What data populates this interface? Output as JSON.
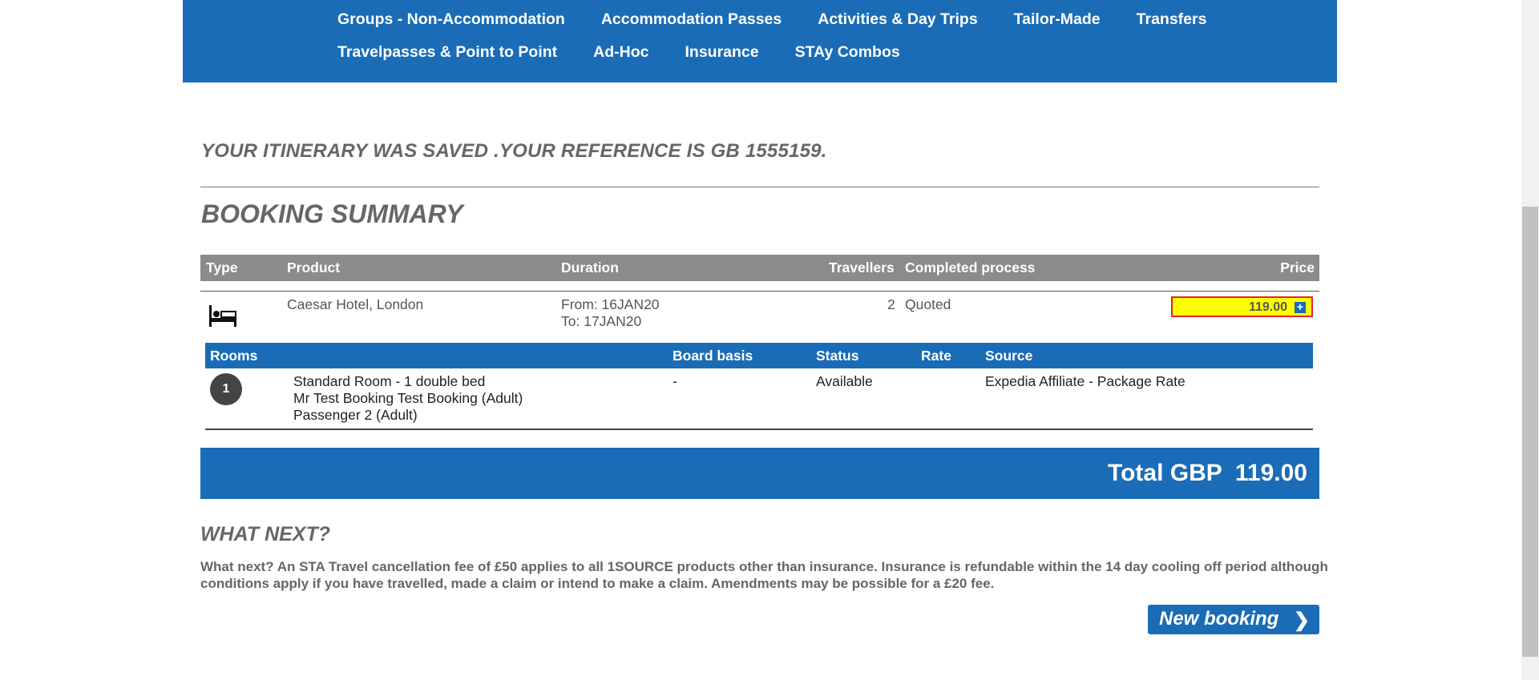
{
  "nav": {
    "row1": [
      "Groups - Non-Accommodation",
      "Accommodation Passes",
      "Activities & Day Trips",
      "Tailor-Made",
      "Transfers"
    ],
    "row2": [
      "Travelpasses & Point to Point",
      "Ad-Hoc",
      "Insurance",
      "STAy Combos"
    ]
  },
  "saved_message": "YOUR ITINERARY WAS SAVED .YOUR REFERENCE IS GB 1555159.",
  "summary_title": "BOOKING SUMMARY",
  "table": {
    "headers": {
      "type": "Type",
      "product": "Product",
      "duration": "Duration",
      "travellers": "Travellers",
      "completed": "Completed process",
      "price": "Price"
    },
    "row": {
      "icon": "bed-icon",
      "product": "Caesar Hotel, London",
      "from": "From: 16JAN20",
      "to": "To: 17JAN20",
      "travellers": "2",
      "status": "Quoted",
      "price": "119.00"
    }
  },
  "rooms": {
    "headers": {
      "rooms": "Rooms",
      "board": "Board basis",
      "status": "Status",
      "rate": "Rate",
      "source": "Source"
    },
    "row": {
      "number": "1",
      "room": "Standard Room - 1 double bed",
      "pax1": "Mr Test Booking Test Booking (Adult)",
      "pax2": "Passenger 2 (Adult)",
      "board": "-",
      "status": "Available",
      "rate": "",
      "source": "Expedia Affiliate - Package Rate"
    }
  },
  "total": "Total GBP  119.00",
  "what_next_title": "WHAT NEXT?",
  "what_next_text": "What next? An STA Travel cancellation fee of £50 applies to all 1SOURCE products other than insurance. Insurance is refundable within the 14 day cooling off period although conditions apply if you have travelled, made a claim or intend to make a claim. Amendments may be possible for a £20 fee.",
  "new_booking_label": "New booking",
  "colors": {
    "brand_blue": "#1a6cb6",
    "header_grey": "#8b8b8b",
    "highlight": "#ffff00",
    "highlight_border": "#e0262b"
  }
}
